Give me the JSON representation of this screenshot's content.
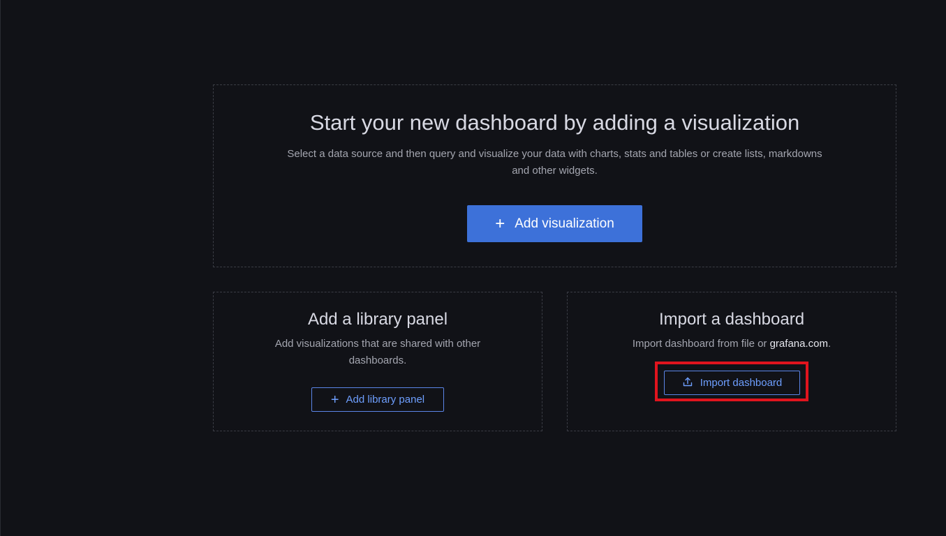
{
  "main": {
    "title": "Start your new dashboard by adding a visualization",
    "description": "Select a data source and then query and visualize your data with charts, stats and tables or create lists, markdowns and other widgets.",
    "add_visualization_label": "Add visualization"
  },
  "library": {
    "title": "Add a library panel",
    "description": "Add visualizations that are shared with other dashboards.",
    "button_label": "Add library panel"
  },
  "import": {
    "title": "Import a dashboard",
    "description_prefix": "Import dashboard from file or ",
    "description_link": "grafana.com",
    "description_suffix": ".",
    "button_label": "Import dashboard"
  },
  "icons": {
    "add": "plus-icon",
    "import": "upload-icon"
  },
  "colors": {
    "background": "#111217",
    "primary_button": "#3d71d9",
    "secondary_text": "#6e9fff",
    "highlight": "#e0141e"
  }
}
